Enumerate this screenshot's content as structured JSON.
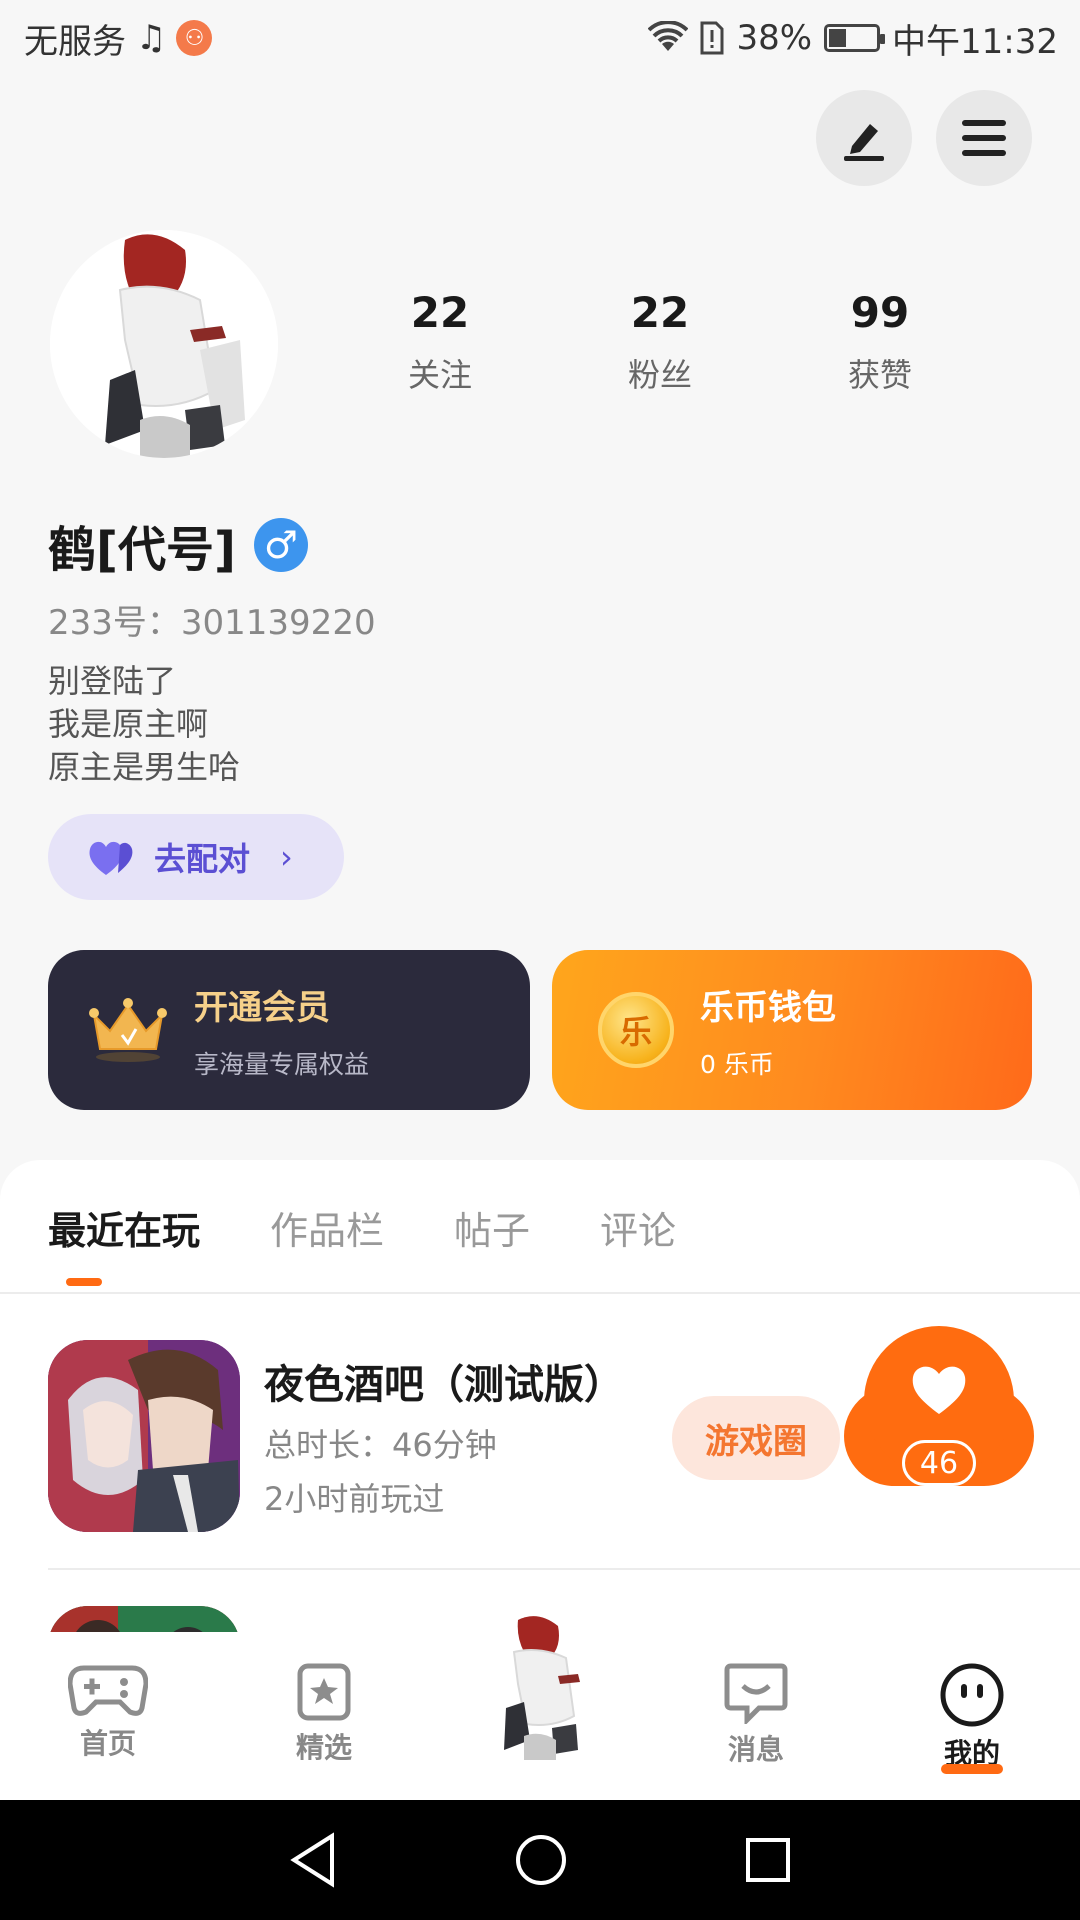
{
  "status_bar": {
    "carrier": "无服务",
    "battery": "38%",
    "battery_level": 0.38,
    "time": "中午11:32"
  },
  "profile": {
    "stats": [
      {
        "value": "22",
        "label": "关注"
      },
      {
        "value": "22",
        "label": "粉丝"
      },
      {
        "value": "99",
        "label": "获赞"
      }
    ],
    "username": "鹤[代号]",
    "gender_symbol": "♂",
    "id_text": "233号：301139220",
    "bio_lines": [
      "别登陆了",
      "我是原主啊",
      "原主是男生哈"
    ],
    "match_button": "去配对"
  },
  "cards": {
    "vip": {
      "title": "开通会员",
      "subtitle": "享海量专属权益"
    },
    "wallet": {
      "title": "乐币钱包",
      "subtitle": "0 乐币",
      "coin_char": "乐"
    }
  },
  "tabs": [
    "最近在玩",
    "作品栏",
    "帖子",
    "评论"
  ],
  "games": [
    {
      "title": "夜色酒吧（测试版）",
      "duration": "总时长：46分钟",
      "last_played": "2小时前玩过",
      "circle_button": "游戏圈",
      "likes": "46"
    }
  ],
  "bottom_nav": [
    {
      "label": "首页",
      "icon": "gamepad-icon"
    },
    {
      "label": "精选",
      "icon": "star-bookmark-icon"
    },
    {
      "label": "",
      "icon": "avatar-center"
    },
    {
      "label": "消息",
      "icon": "chat-smile-icon"
    },
    {
      "label": "我的",
      "icon": "face-icon"
    }
  ],
  "colors": {
    "accent": "#ff6a13",
    "match_purple": "#5b4fd3",
    "vip_dark": "#2b2a3c"
  }
}
